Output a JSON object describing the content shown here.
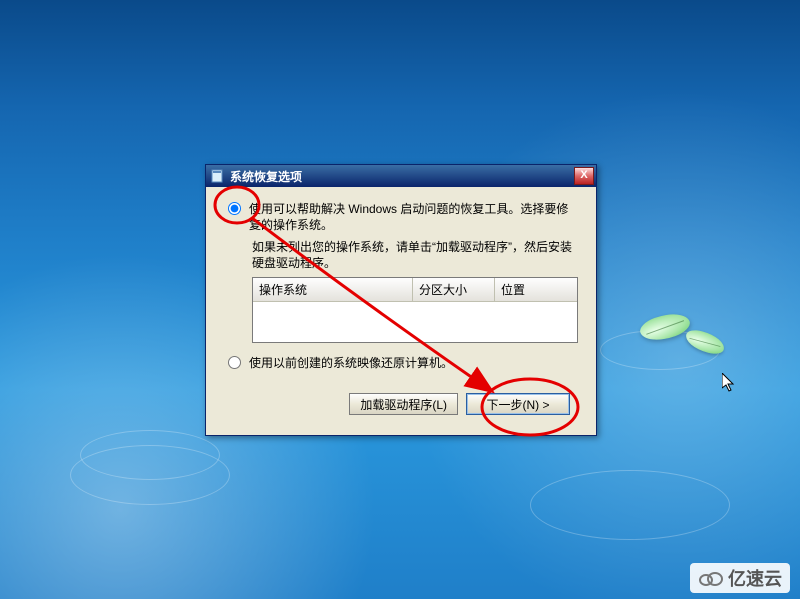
{
  "dialog": {
    "title": "系统恢复选项",
    "close_label": "X",
    "option1": {
      "text": "使用可以帮助解决 Windows 启动问题的恢复工具。选择要修复的操作系统。"
    },
    "hint": "如果未列出您的操作系统，请单击“加载驱动程序”，然后安装硬盘驱动程序。",
    "table": {
      "col1": "操作系统",
      "col2": "分区大小",
      "col3": "位置"
    },
    "option2": {
      "text": "使用以前创建的系统映像还原计算机。"
    },
    "buttons": {
      "load_driver": "加载驱动程序(L)",
      "next": "下一步(N) >"
    }
  },
  "watermark": {
    "text": "亿速云"
  },
  "colors": {
    "annotation": "#e40000"
  }
}
